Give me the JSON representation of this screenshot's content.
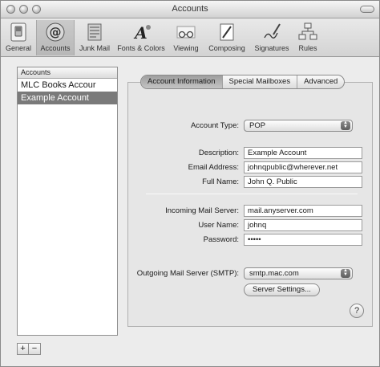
{
  "window": {
    "title": "Accounts"
  },
  "toolbar": {
    "items": [
      {
        "label": "General",
        "icon": "general-switch-icon"
      },
      {
        "label": "Accounts",
        "icon": "at-sign-icon"
      },
      {
        "label": "Junk Mail",
        "icon": "junk-mail-icon"
      },
      {
        "label": "Fonts & Colors",
        "icon": "fonts-colors-icon"
      },
      {
        "label": "Viewing",
        "icon": "glasses-icon"
      },
      {
        "label": "Composing",
        "icon": "pencil-pad-icon"
      },
      {
        "label": "Signatures",
        "icon": "signature-pen-icon"
      },
      {
        "label": "Rules",
        "icon": "rules-flowchart-icon"
      }
    ],
    "selected": "Accounts"
  },
  "accounts_list": {
    "header": "Accounts",
    "items": [
      "MLC Books Accour",
      "Example Account"
    ],
    "selected": "Example Account",
    "add_label": "+",
    "remove_label": "−"
  },
  "tabs": [
    "Account Information",
    "Special Mailboxes",
    "Advanced"
  ],
  "active_tab": "Account Information",
  "form": {
    "account_type_label": "Account Type:",
    "account_type_value": "POP",
    "description_label": "Description:",
    "description_value": "Example Account",
    "email_label": "Email Address:",
    "email_value": "johnqpublic@wherever.net",
    "fullname_label": "Full Name:",
    "fullname_value": "John Q. Public",
    "incoming_label": "Incoming Mail Server:",
    "incoming_value": "mail.anyserver.com",
    "username_label": "User Name:",
    "username_value": "johnq",
    "password_label": "Password:",
    "password_value": "•••••",
    "smtp_label": "Outgoing Mail Server (SMTP):",
    "smtp_value": "smtp.mac.com",
    "server_settings_label": "Server Settings..."
  },
  "help": "?",
  "colors": {
    "selection_gray": "#7a7a7a",
    "toolbar_bg": "#dcdcdc",
    "window_bg": "#ececec"
  }
}
